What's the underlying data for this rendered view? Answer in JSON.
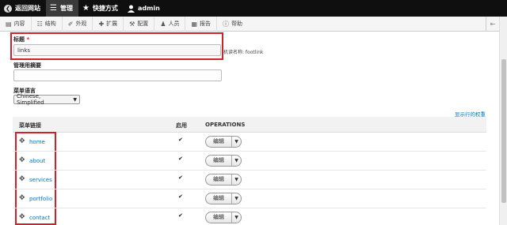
{
  "topbar": {
    "back_label": "返回网站",
    "manage_label": "管理",
    "shortcuts_label": "快捷方式",
    "user_label": "admin"
  },
  "toolbar2": {
    "items": [
      {
        "label": "内容",
        "icon": "document-icon"
      },
      {
        "label": "结构",
        "icon": "structure-icon"
      },
      {
        "label": "外观",
        "icon": "paint-icon"
      },
      {
        "label": "扩展",
        "icon": "puzzle-icon"
      },
      {
        "label": "配置",
        "icon": "wrench-icon"
      },
      {
        "label": "人员",
        "icon": "people-icon"
      },
      {
        "label": "报告",
        "icon": "chart-icon"
      },
      {
        "label": "帮助",
        "icon": "help-icon"
      }
    ]
  },
  "form": {
    "title_label": "标题",
    "required_mark": "*",
    "title_value": "links",
    "machine_name": "机读名称: footlink",
    "summary_label": "管理用摘要",
    "summary_value": "",
    "language_label": "菜单语言",
    "language_value": "Chinese, Simplified"
  },
  "table": {
    "show_weights": "显示行的权重",
    "headers": {
      "link": "菜单链接",
      "enabled": "启用",
      "operations": "OPERATIONS"
    },
    "edit_label": "编辑",
    "rows": [
      {
        "label": "home",
        "enabled": true
      },
      {
        "label": "about",
        "enabled": true
      },
      {
        "label": "services",
        "enabled": true
      },
      {
        "label": "portfolio",
        "enabled": true
      },
      {
        "label": "contact",
        "enabled": true
      }
    ]
  },
  "colors": {
    "highlight": "#d0202a",
    "link": "#0074bd",
    "topbar": "#0f0f0f"
  }
}
